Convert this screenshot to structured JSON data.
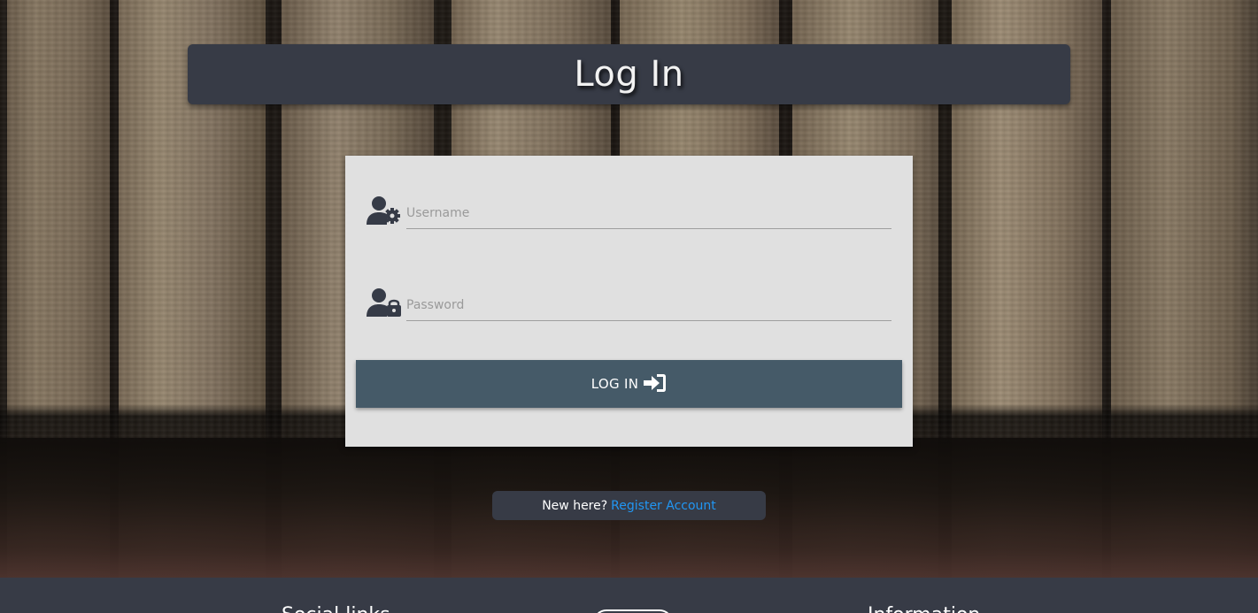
{
  "page": {
    "title": "Log In"
  },
  "form": {
    "username_placeholder": "Username",
    "password_placeholder": "Password",
    "username_icon": "user-gear-icon",
    "password_icon": "user-lock-icon",
    "login_button_label": "LOG IN",
    "login_button_icon": "sign-in-icon"
  },
  "register": {
    "prompt": "New here?",
    "link_label": "Register Account"
  },
  "footer": {
    "social_heading": "Social links",
    "info_heading": "Information"
  },
  "colors": {
    "title_bar": "#373b46",
    "card": "#e0e0e0",
    "button": "#455a68",
    "link": "#2196f3",
    "footer": "#373b46"
  }
}
